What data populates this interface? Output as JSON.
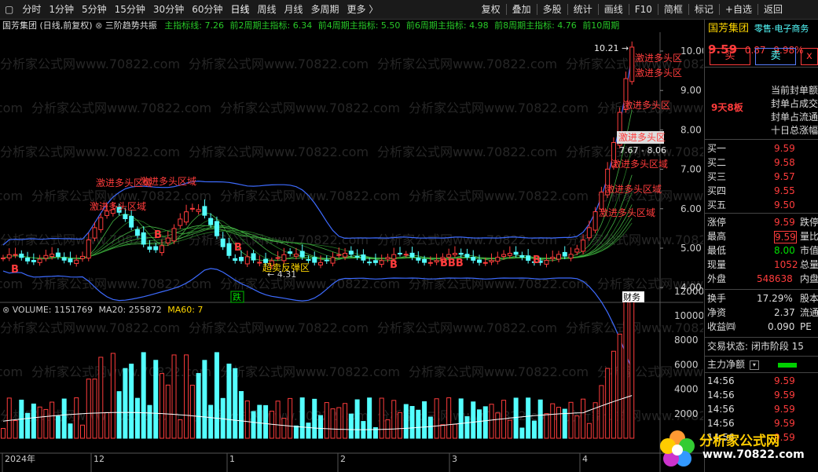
{
  "toolbar": {
    "left": [
      "分时",
      "1分钟",
      "5分钟",
      "15分钟",
      "30分钟",
      "60分钟",
      "日线",
      "周线",
      "月线",
      "多周期",
      "更多 〉"
    ],
    "active": 6,
    "right": [
      "复权",
      "叠加",
      "多股",
      "统计",
      "画线",
      "F10",
      "简框",
      "标记",
      "+自选",
      "返回"
    ]
  },
  "info": {
    "title": "国芳集团 (日线,前复权)",
    "indicator": "三阶趋势共振",
    "m0": "主指标线: 7.26",
    "m2": "前2周期主指标: 6.34",
    "m4": "前4周期主指标: 5.50",
    "m6": "前6周期主指标: 4.98",
    "m8": "前8周期主指标: 4.76",
    "m10": "前10周期"
  },
  "price_axis": [
    "10.00",
    "9.00",
    "8.00",
    "7.00",
    "6.00",
    "5.00",
    "4.00"
  ],
  "vol_axis": [
    "12000",
    "10000",
    "8000",
    "6000",
    "4000",
    "2000"
  ],
  "annotations": {
    "high": "10.21",
    "low": "4.31",
    "range": "7.67 - 8.06",
    "jjdt": "激进多头区域",
    "jjdt_short": "激进多头区",
    "cmft": "超卖反弹区",
    "b": "B",
    "bbb": "BBB",
    "die": "跌",
    "fa": "财务",
    "watermark": "分析家公式网www.70822.com"
  },
  "volume": {
    "label": "VOLUME: 1151769",
    "ma20": "MA20: 255872",
    "ma60": "MA60: 7"
  },
  "dates": [
    "2024年",
    "12",
    "1",
    "2",
    "3",
    "4"
  ],
  "stock": {
    "name": "国芳集团",
    "tags": "零售·电子商务",
    "price": "9.59",
    "change": "0.87",
    "pct": "9.98%",
    "buy": "买",
    "sell": "卖",
    "streak": "9天8板",
    "notes": [
      "当前封单额",
      "封单占成交",
      "封单占流通",
      "十日总涨幅"
    ]
  },
  "order_book": [
    {
      "label": "买一",
      "price": "9.59"
    },
    {
      "label": "买二",
      "price": "9.58"
    },
    {
      "label": "买三",
      "price": "9.57"
    },
    {
      "label": "买四",
      "price": "9.55"
    },
    {
      "label": "买五",
      "price": "9.50"
    }
  ],
  "stats": [
    {
      "label": "涨停",
      "value": "9.59",
      "extra": "跌停"
    },
    {
      "label": "最高",
      "value": "9.59",
      "extra": "量比"
    },
    {
      "label": "最低",
      "value": "8.00",
      "extra": "市值"
    },
    {
      "label": "现量",
      "value": "1052",
      "extra": "总量"
    },
    {
      "label": "外盘",
      "value": "548638",
      "extra": "内盘"
    }
  ],
  "stats2": [
    {
      "label": "换手",
      "value": "17.29%",
      "extra": "股本"
    },
    {
      "label": "净资",
      "value": "2.37",
      "extra": "流通"
    },
    {
      "label": "收益㈣",
      "value": "0.090",
      "extra": "PE"
    }
  ],
  "trade_status": "交易状态: 闭市阶段 15",
  "main_flow": "主力净额",
  "ticks": [
    {
      "time": "14:56",
      "price": "9.59"
    },
    {
      "time": "14:56",
      "price": "9.59"
    },
    {
      "time": "14:56",
      "price": "9.59"
    },
    {
      "time": "14:56",
      "price": "9.59"
    },
    {
      "time": "14:56",
      "price": "9.59"
    }
  ],
  "logo": {
    "line1": "分析家公式网",
    "line2": "www.70822.com"
  },
  "colors": {
    "up": "#ff3c3c",
    "down": "#54ffff",
    "accent": "#ffd700"
  }
}
